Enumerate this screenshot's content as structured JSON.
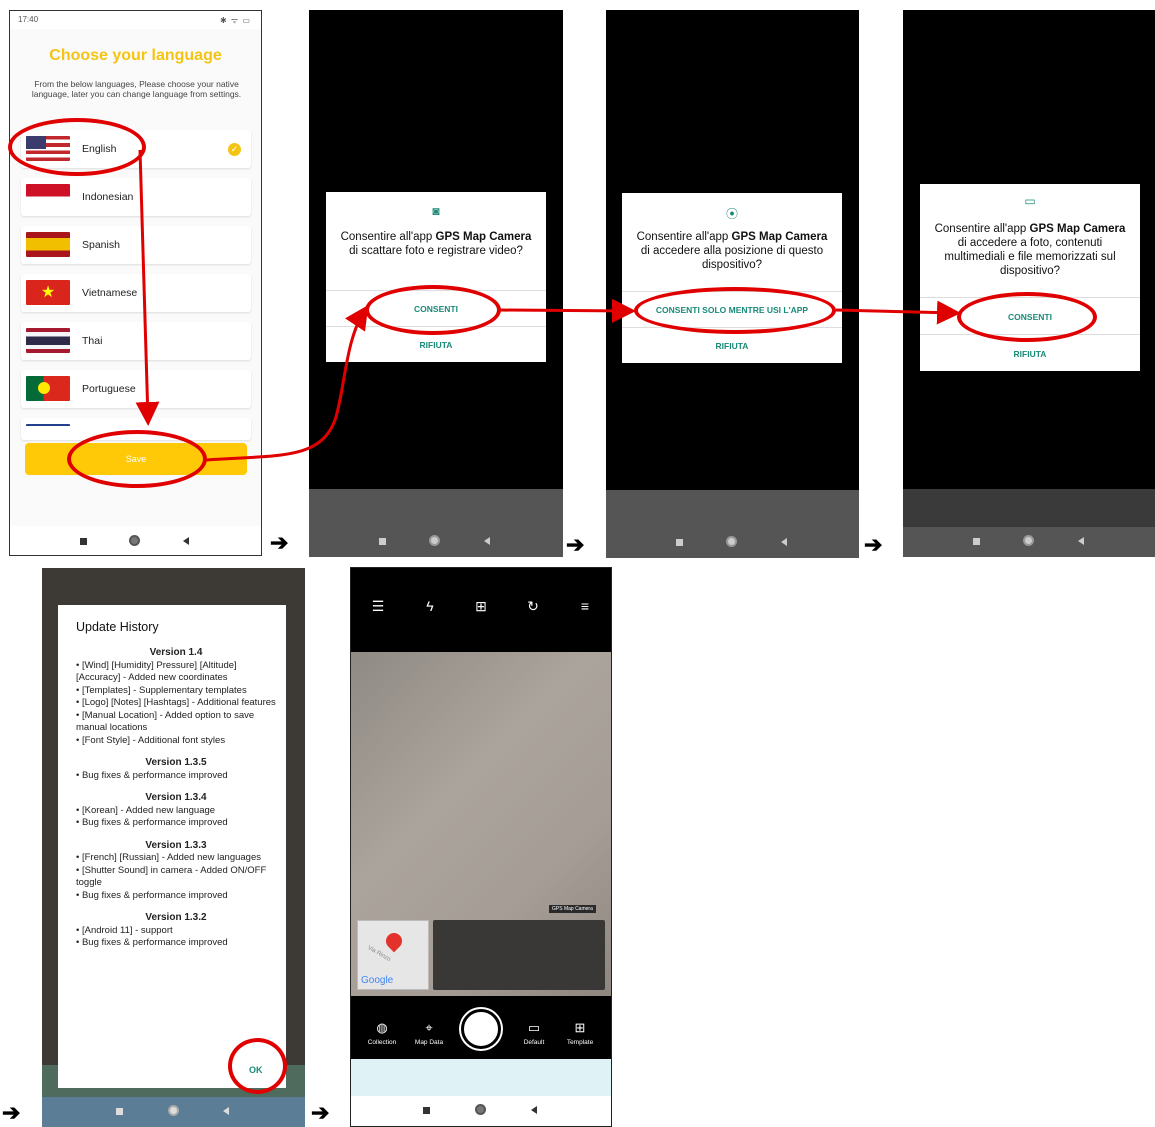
{
  "screen1": {
    "status_time": "17:40",
    "title": "Choose your language",
    "description": "From the below languages, Please choose your native language, later you can change language from settings.",
    "languages": [
      {
        "name": "English",
        "selected": true
      },
      {
        "name": "Indonesian",
        "selected": false
      },
      {
        "name": "Spanish",
        "selected": false
      },
      {
        "name": "Vietnamese",
        "selected": false
      },
      {
        "name": "Thai",
        "selected": false
      },
      {
        "name": "Portuguese",
        "selected": false
      }
    ],
    "save_label": "Save",
    "accent_color": "#F5C412"
  },
  "screen2": {
    "icon": "camera-icon",
    "message_pre": "Consentire all'app ",
    "app_name": "GPS Map Camera",
    "message_post": " di scattare foto e registrare video?",
    "allow_label": "CONSENTI",
    "deny_label": "RIFIUTA"
  },
  "screen3": {
    "icon": "location-icon",
    "message_pre": "Consentire all'app ",
    "app_name": "GPS Map Camera",
    "message_post": " di accedere alla posizione di questo dispositivo?",
    "allow_label": "CONSENTI SOLO MENTRE USI L'APP",
    "deny_label": "RIFIUTA"
  },
  "screen4": {
    "icon": "folder-icon",
    "message_pre": "Consentire all'app ",
    "app_name": "GPS Map Camera",
    "message_post": " di accedere a foto, contenuti multimediali e file memorizzati sul dispositivo?",
    "allow_label": "CONSENTI",
    "deny_label": "RIFIUTA"
  },
  "screen5": {
    "title": "Update History",
    "versions": [
      {
        "version": "Version 1.4",
        "items": [
          "• [Wind] [Humidity] Pressure] [Altitude] [Accuracy] - Added new coordinates",
          "• [Templates] - Supplementary templates",
          "• [Logo] [Notes] [Hashtags] - Additional features",
          "• [Manual Location] - Added option to save manual locations",
          "• [Font Style] - Additional font styles"
        ]
      },
      {
        "version": "Version 1.3.5",
        "items": [
          "• Bug fixes & performance improved"
        ]
      },
      {
        "version": "Version 1.3.4",
        "items": [
          "• [Korean] - Added new language",
          "• Bug fixes & performance improved"
        ]
      },
      {
        "version": "Version 1.3.3",
        "items": [
          "• [French] [Russian] - Added new languages",
          "• [Shutter Sound] in camera - Added ON/OFF toggle",
          "• Bug fixes & performance improved"
        ]
      },
      {
        "version": "Version 1.3.2",
        "items": [
          "• [Android 11] - support",
          "• Bug fixes & performance improved"
        ]
      }
    ],
    "ok_label": "OK"
  },
  "screen6": {
    "toolbar_icons": [
      "menu-icon",
      "flash-icon",
      "add-file-icon",
      "flip-camera-icon",
      "settings-sliders-icon"
    ],
    "badge_label": "GPS Map Camera",
    "map_brand": "Google",
    "map_street": "Via Rinzo",
    "controls": [
      {
        "label": "Collection",
        "icon": "collection-icon"
      },
      {
        "label": "Map Data",
        "icon": "map-data-icon"
      },
      {
        "label": "Default",
        "icon": "folder-icon"
      },
      {
        "label": "Template",
        "icon": "template-icon"
      }
    ]
  },
  "colors": {
    "annotation": "#E00000",
    "teal": "#1A8A78",
    "save": "#FFC907"
  }
}
